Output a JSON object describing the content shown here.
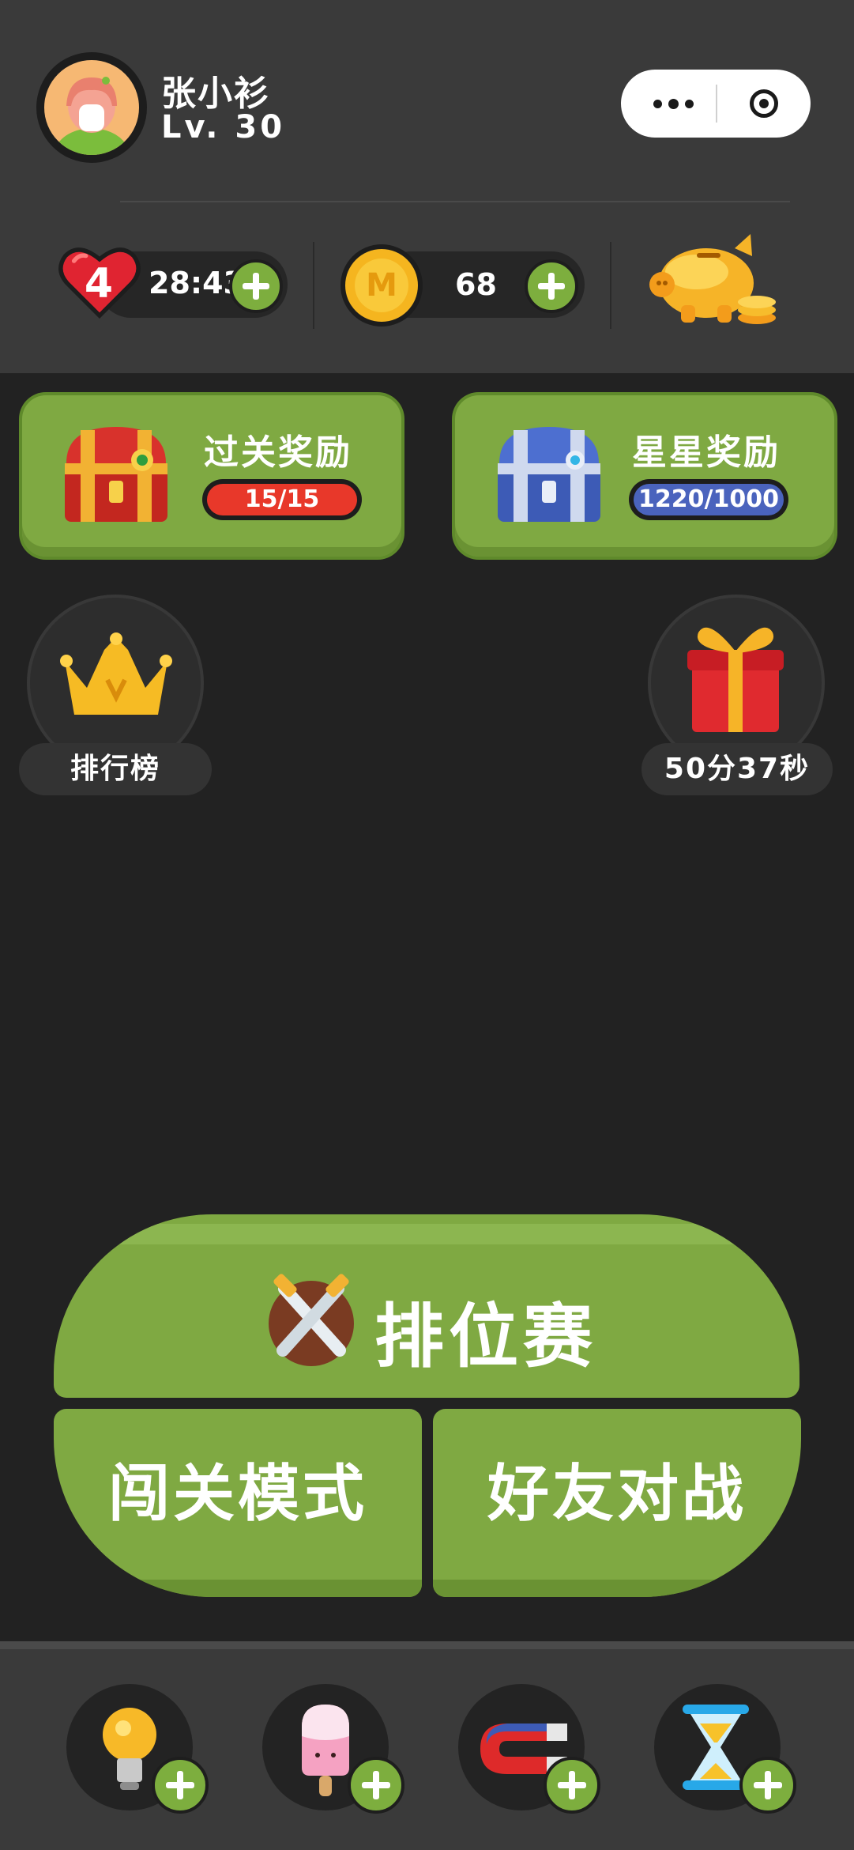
{
  "user": {
    "name": "张小衫",
    "level": "Lv. 30"
  },
  "capsule": {
    "more_icon": "more-dots-icon",
    "close_icon": "target-close-icon"
  },
  "resources": {
    "lives": {
      "count": "4",
      "timer": "28:43"
    },
    "coins": {
      "amount": "68",
      "symbol": "M"
    },
    "piggy_bank_icon": "piggy-bank-icon"
  },
  "rewards": [
    {
      "title": "过关奖励",
      "progress": "15/15",
      "fraction": 1.0,
      "color": "#e8382a"
    },
    {
      "title": "星星奖励",
      "progress": "1220/1000",
      "fraction": 1.0,
      "color": "#4a63bd"
    }
  ],
  "side": {
    "leaderboard_label": "排行榜",
    "gift_timer": "50分37秒"
  },
  "modes": {
    "ranked": "排位赛",
    "level_mode": "闯关模式",
    "friend_battle": "好友对战"
  },
  "tools": [
    {
      "icon": "lightbulb-icon"
    },
    {
      "icon": "popsicle-icon"
    },
    {
      "icon": "magnet-icon"
    },
    {
      "icon": "hourglass-icon"
    }
  ],
  "colors": {
    "accent_green": "#7fa942",
    "background": "#222222",
    "header": "#3a3a3a"
  }
}
